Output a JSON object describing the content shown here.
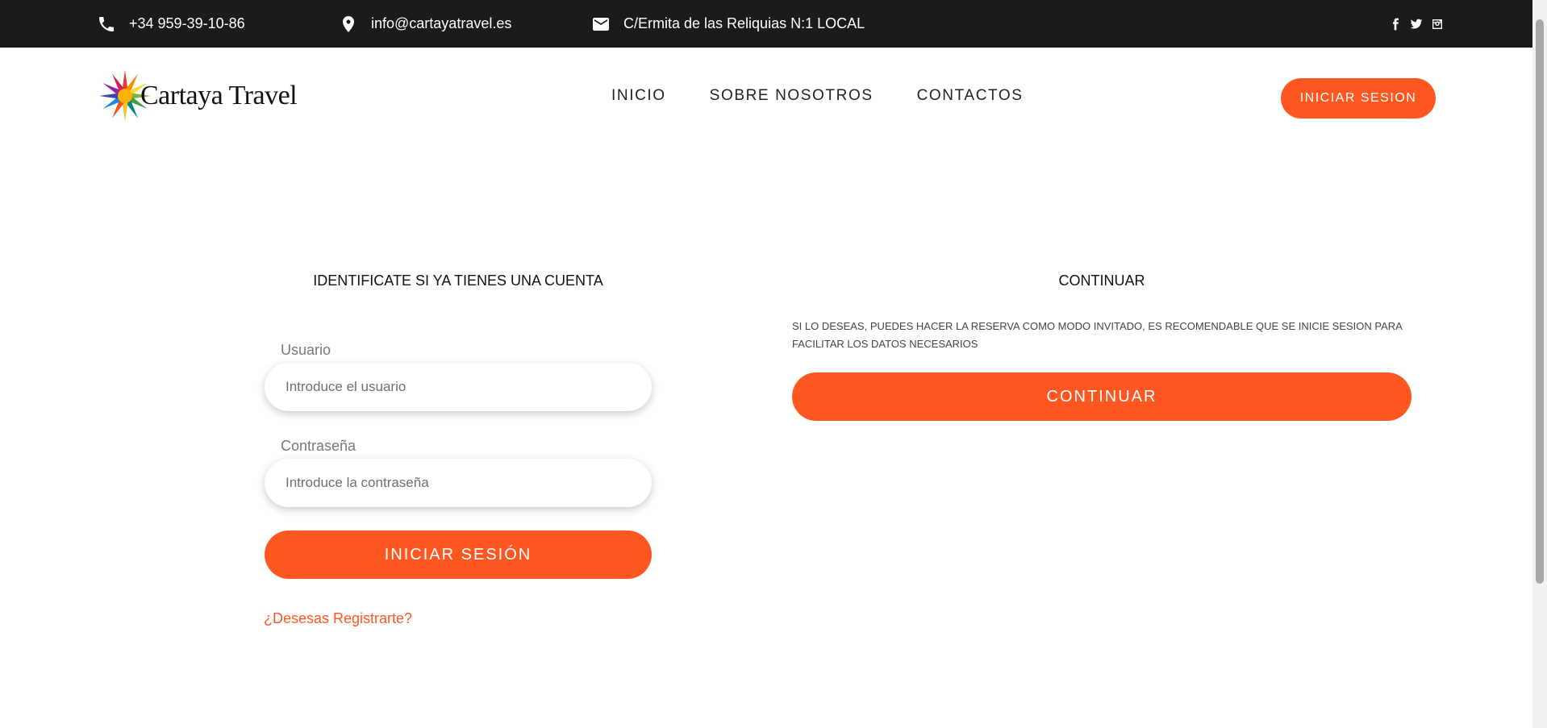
{
  "topbar": {
    "phone": "+34 959-39-10-86",
    "email": "info@cartayatravel.es",
    "address": "C/Ermita de las Reliquias N:1 LOCAL",
    "social": [
      "facebook-icon",
      "twitter-icon",
      "instagram-icon"
    ]
  },
  "header": {
    "brand": "Cartaya Travel",
    "nav": [
      "INICIO",
      "SOBRE NOSOTROS",
      "CONTACTOS"
    ],
    "login_button": "INICIAR SESION"
  },
  "login": {
    "title": "IDENTIFICATE SI YA TIENES UNA CUENTA",
    "user_label": "Usuario",
    "user_placeholder": "Introduce el usuario",
    "user_value": "",
    "pass_label": "Contraseña",
    "pass_placeholder": "Introduce la contraseña",
    "pass_value": "",
    "submit": "INICIAR SESIÓN",
    "register_link": "¿Desesas Registrarte?"
  },
  "guest": {
    "title": "CONTINUAR",
    "description": "SI LO DESEAS, PUEDES HACER LA RESERVA COMO MODO INVITADO, ES RECOMENDABLE QUE SE INICIE SESION PARA FACILITAR LOS DATOS NECESARIOS",
    "button": "CONTINUAR"
  },
  "colors": {
    "accent": "#ff5722",
    "topbar": "#1b1b1b"
  }
}
